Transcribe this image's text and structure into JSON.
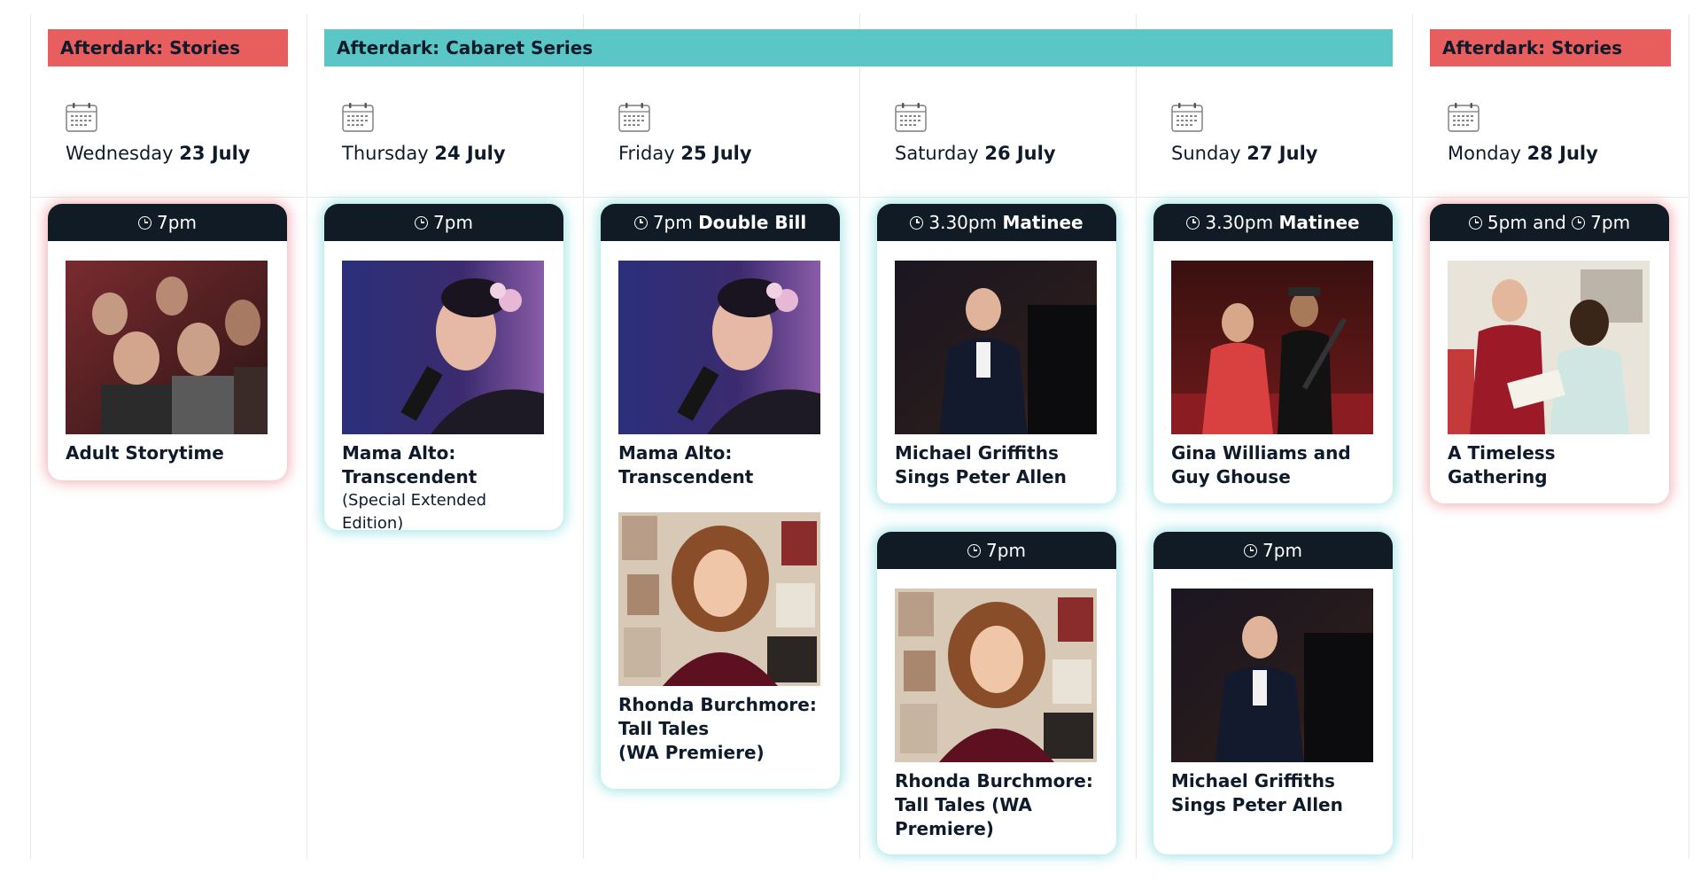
{
  "columns": [
    {
      "weekday": "Wednesday",
      "date": "23 July"
    },
    {
      "weekday": "Thursday",
      "date": "24 July"
    },
    {
      "weekday": "Friday",
      "date": "25 July"
    },
    {
      "weekday": "Saturday",
      "date": "26 July"
    },
    {
      "weekday": "Sunday",
      "date": "27 July"
    },
    {
      "weekday": "Monday",
      "date": "28 July"
    }
  ],
  "series": {
    "left": "Afterdark: Stories",
    "middle": "Afterdark: Cabaret Series",
    "right": "Afterdark: Stories"
  },
  "colors": {
    "stories": "#e85e5e",
    "cabaret": "#5bc6c6",
    "header": "#101b26"
  },
  "cards": {
    "wed": {
      "time": "7pm",
      "extra": "",
      "title": "Adult Storytime"
    },
    "thu": {
      "time": "7pm",
      "extra": "",
      "title_line1": "Mama Alto:",
      "title_line2": "Transcendent",
      "subtitle": "(Special Extended Edition)"
    },
    "fri": {
      "time": "7pm",
      "extra": "Double Bill",
      "show1_line1": "Mama Alto:",
      "show1_line2": "Transcendent",
      "show2_line1": "Rhonda Burchmore:",
      "show2_line2": "Tall Tales",
      "show2_line3": "(WA Premiere)"
    },
    "sat1": {
      "time": "3.30pm",
      "extra": "Matinee",
      "title_line1": "Michael Griffiths",
      "title_line2": "Sings Peter Allen"
    },
    "sat2": {
      "time": "7pm",
      "title_line1": "Rhonda Burchmore:",
      "title_line2": "Tall Tales (WA",
      "title_line3": "Premiere)"
    },
    "sun1": {
      "time": "3.30pm",
      "extra": "Matinee",
      "title_line1": "Gina Williams and",
      "title_line2": "Guy Ghouse"
    },
    "sun2": {
      "time": "7pm",
      "title_line1": "Michael Griffiths",
      "title_line2": "Sings Peter Allen"
    },
    "mon": {
      "time1": "5pm and",
      "time2": "7pm",
      "title_line1": "A Timeless",
      "title_line2": "Gathering"
    }
  }
}
